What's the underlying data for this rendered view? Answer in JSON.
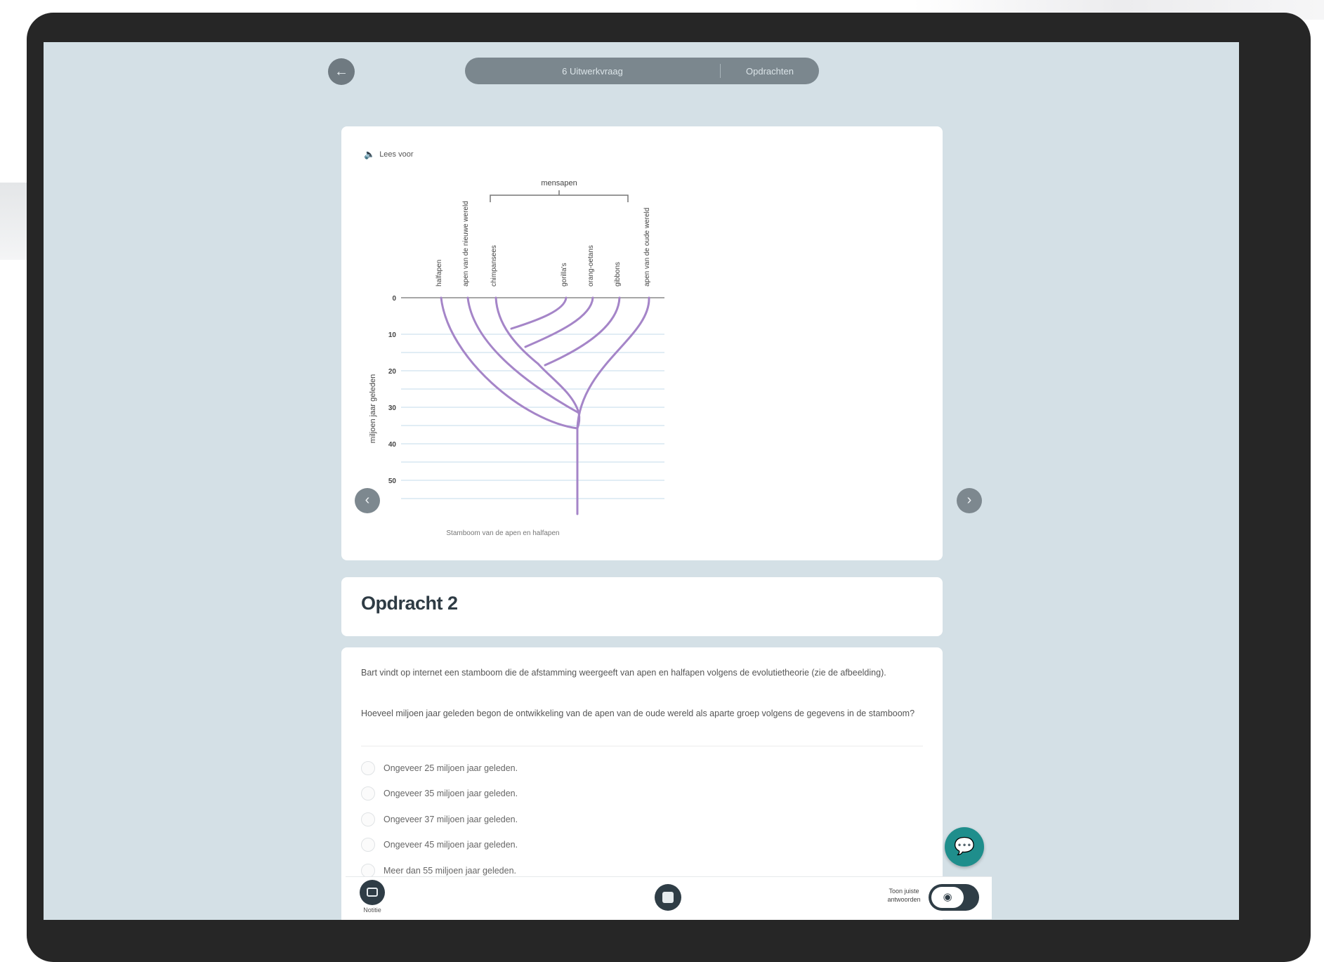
{
  "topbar": {
    "back_icon": "arrow-left-icon",
    "title": "6 Uitwerkvraag",
    "action_label": "Opdrachten"
  },
  "figure": {
    "read_aloud_label": "Lees voor",
    "bracket_label": "mensapen",
    "species": [
      "halfapen",
      "apen van de nieuwe wereld",
      "chimpansees",
      "gorilla's",
      "orang-oetans",
      "gibbons",
      "apen van de oude wereld"
    ],
    "y_axis_label": "miljoen jaar geleden",
    "y_ticks": [
      "0",
      "10",
      "20",
      "30",
      "40",
      "50"
    ],
    "caption": "Stamboom van de apen en halfapen",
    "tree_color": "#a585c8"
  },
  "navigation": {
    "prev_icon": "chevron-left-icon",
    "next_icon": "chevron-right-icon"
  },
  "assignment": {
    "title": "Opdracht 2",
    "intro": "Bart vindt op internet een stamboom die de afstamming weergeeft van apen en halfapen volgens de evolutietheorie (zie de afbeelding).",
    "question": "Hoeveel miljoen jaar geleden begon de ontwikkeling van de apen van de oude wereld als aparte groep volgens de gegevens in de stamboom?",
    "options": [
      "Ongeveer 25 miljoen jaar geleden.",
      "Ongeveer 35 miljoen jaar geleden.",
      "Ongeveer 37 miljoen jaar geleden.",
      "Ongeveer 45 miljoen jaar geleden.",
      "Meer dan 55 miljoen jaar geleden."
    ]
  },
  "fab": {
    "icon": "chat-icon"
  },
  "bottombar": {
    "note_label": "Notitie",
    "toggle_label": "Toon juiste antwoorden",
    "toggle_icon": "eye-off-icon"
  }
}
